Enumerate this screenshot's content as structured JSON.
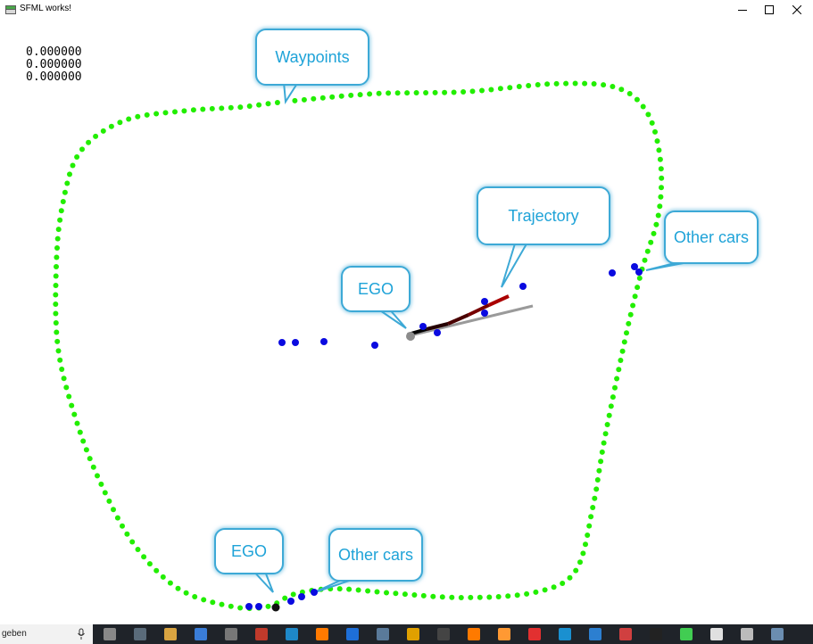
{
  "window": {
    "title": "SFML works!",
    "minimize_icon": "minimize-icon",
    "maximize_icon": "maximize-icon",
    "close_icon": "close-icon"
  },
  "readout": {
    "lines": [
      "0.000000",
      "0.000000",
      "0.000000"
    ]
  },
  "callouts": {
    "waypoints": "Waypoints",
    "trajectory": "Trajectory",
    "ego_top": "EGO",
    "ego_bottom": "EGO",
    "other_cars_right": "Other cars",
    "other_cars_bottom": "Other cars"
  },
  "colors": {
    "waypoint": "#22ee00",
    "other_car": "#0a0ae0",
    "trajectory_start": "#000000",
    "trajectory_end": "#aa0000",
    "heading_line": "#9a9a9a",
    "ego": "#8c8c8c",
    "callout_border": "#3da9d6",
    "callout_text": "#1fa3d8",
    "taskbar": "#1f2329"
  },
  "taskbar": {
    "search_text": "geben",
    "icons": [
      "microphone-icon",
      "task-view-icon",
      "snipping-tool-icon",
      "file-explorer-icon",
      "store-icon",
      "settings-icon",
      "app-icon",
      "window-icon",
      "firefox-icon",
      "edge-icon",
      "steam-icon",
      "sublime-text-icon",
      "x-app-icon",
      "firefox-icon-2",
      "scratch-icon",
      "chrome-icon",
      "music-icon",
      "remote-desktop-icon",
      "game-icon",
      "terminal-icon",
      "qt-creator-icon",
      "car-game-icon",
      "visual-studio-icon",
      "sfml-app-icon"
    ]
  }
}
